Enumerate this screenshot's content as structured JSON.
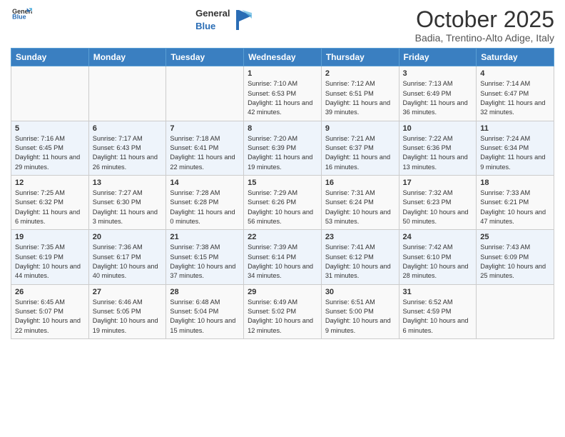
{
  "header": {
    "logo_general": "General",
    "logo_blue": "Blue",
    "month": "October 2025",
    "location": "Badia, Trentino-Alto Adige, Italy"
  },
  "days_of_week": [
    "Sunday",
    "Monday",
    "Tuesday",
    "Wednesday",
    "Thursday",
    "Friday",
    "Saturday"
  ],
  "weeks": [
    [
      {
        "day": "",
        "info": ""
      },
      {
        "day": "",
        "info": ""
      },
      {
        "day": "",
        "info": ""
      },
      {
        "day": "1",
        "info": "Sunrise: 7:10 AM\nSunset: 6:53 PM\nDaylight: 11 hours and 42 minutes."
      },
      {
        "day": "2",
        "info": "Sunrise: 7:12 AM\nSunset: 6:51 PM\nDaylight: 11 hours and 39 minutes."
      },
      {
        "day": "3",
        "info": "Sunrise: 7:13 AM\nSunset: 6:49 PM\nDaylight: 11 hours and 36 minutes."
      },
      {
        "day": "4",
        "info": "Sunrise: 7:14 AM\nSunset: 6:47 PM\nDaylight: 11 hours and 32 minutes."
      }
    ],
    [
      {
        "day": "5",
        "info": "Sunrise: 7:16 AM\nSunset: 6:45 PM\nDaylight: 11 hours and 29 minutes."
      },
      {
        "day": "6",
        "info": "Sunrise: 7:17 AM\nSunset: 6:43 PM\nDaylight: 11 hours and 26 minutes."
      },
      {
        "day": "7",
        "info": "Sunrise: 7:18 AM\nSunset: 6:41 PM\nDaylight: 11 hours and 22 minutes."
      },
      {
        "day": "8",
        "info": "Sunrise: 7:20 AM\nSunset: 6:39 PM\nDaylight: 11 hours and 19 minutes."
      },
      {
        "day": "9",
        "info": "Sunrise: 7:21 AM\nSunset: 6:37 PM\nDaylight: 11 hours and 16 minutes."
      },
      {
        "day": "10",
        "info": "Sunrise: 7:22 AM\nSunset: 6:36 PM\nDaylight: 11 hours and 13 minutes."
      },
      {
        "day": "11",
        "info": "Sunrise: 7:24 AM\nSunset: 6:34 PM\nDaylight: 11 hours and 9 minutes."
      }
    ],
    [
      {
        "day": "12",
        "info": "Sunrise: 7:25 AM\nSunset: 6:32 PM\nDaylight: 11 hours and 6 minutes."
      },
      {
        "day": "13",
        "info": "Sunrise: 7:27 AM\nSunset: 6:30 PM\nDaylight: 11 hours and 3 minutes."
      },
      {
        "day": "14",
        "info": "Sunrise: 7:28 AM\nSunset: 6:28 PM\nDaylight: 11 hours and 0 minutes."
      },
      {
        "day": "15",
        "info": "Sunrise: 7:29 AM\nSunset: 6:26 PM\nDaylight: 10 hours and 56 minutes."
      },
      {
        "day": "16",
        "info": "Sunrise: 7:31 AM\nSunset: 6:24 PM\nDaylight: 10 hours and 53 minutes."
      },
      {
        "day": "17",
        "info": "Sunrise: 7:32 AM\nSunset: 6:23 PM\nDaylight: 10 hours and 50 minutes."
      },
      {
        "day": "18",
        "info": "Sunrise: 7:33 AM\nSunset: 6:21 PM\nDaylight: 10 hours and 47 minutes."
      }
    ],
    [
      {
        "day": "19",
        "info": "Sunrise: 7:35 AM\nSunset: 6:19 PM\nDaylight: 10 hours and 44 minutes."
      },
      {
        "day": "20",
        "info": "Sunrise: 7:36 AM\nSunset: 6:17 PM\nDaylight: 10 hours and 40 minutes."
      },
      {
        "day": "21",
        "info": "Sunrise: 7:38 AM\nSunset: 6:15 PM\nDaylight: 10 hours and 37 minutes."
      },
      {
        "day": "22",
        "info": "Sunrise: 7:39 AM\nSunset: 6:14 PM\nDaylight: 10 hours and 34 minutes."
      },
      {
        "day": "23",
        "info": "Sunrise: 7:41 AM\nSunset: 6:12 PM\nDaylight: 10 hours and 31 minutes."
      },
      {
        "day": "24",
        "info": "Sunrise: 7:42 AM\nSunset: 6:10 PM\nDaylight: 10 hours and 28 minutes."
      },
      {
        "day": "25",
        "info": "Sunrise: 7:43 AM\nSunset: 6:09 PM\nDaylight: 10 hours and 25 minutes."
      }
    ],
    [
      {
        "day": "26",
        "info": "Sunrise: 6:45 AM\nSunset: 5:07 PM\nDaylight: 10 hours and 22 minutes."
      },
      {
        "day": "27",
        "info": "Sunrise: 6:46 AM\nSunset: 5:05 PM\nDaylight: 10 hours and 19 minutes."
      },
      {
        "day": "28",
        "info": "Sunrise: 6:48 AM\nSunset: 5:04 PM\nDaylight: 10 hours and 15 minutes."
      },
      {
        "day": "29",
        "info": "Sunrise: 6:49 AM\nSunset: 5:02 PM\nDaylight: 10 hours and 12 minutes."
      },
      {
        "day": "30",
        "info": "Sunrise: 6:51 AM\nSunset: 5:00 PM\nDaylight: 10 hours and 9 minutes."
      },
      {
        "day": "31",
        "info": "Sunrise: 6:52 AM\nSunset: 4:59 PM\nDaylight: 10 hours and 6 minutes."
      },
      {
        "day": "",
        "info": ""
      }
    ]
  ]
}
